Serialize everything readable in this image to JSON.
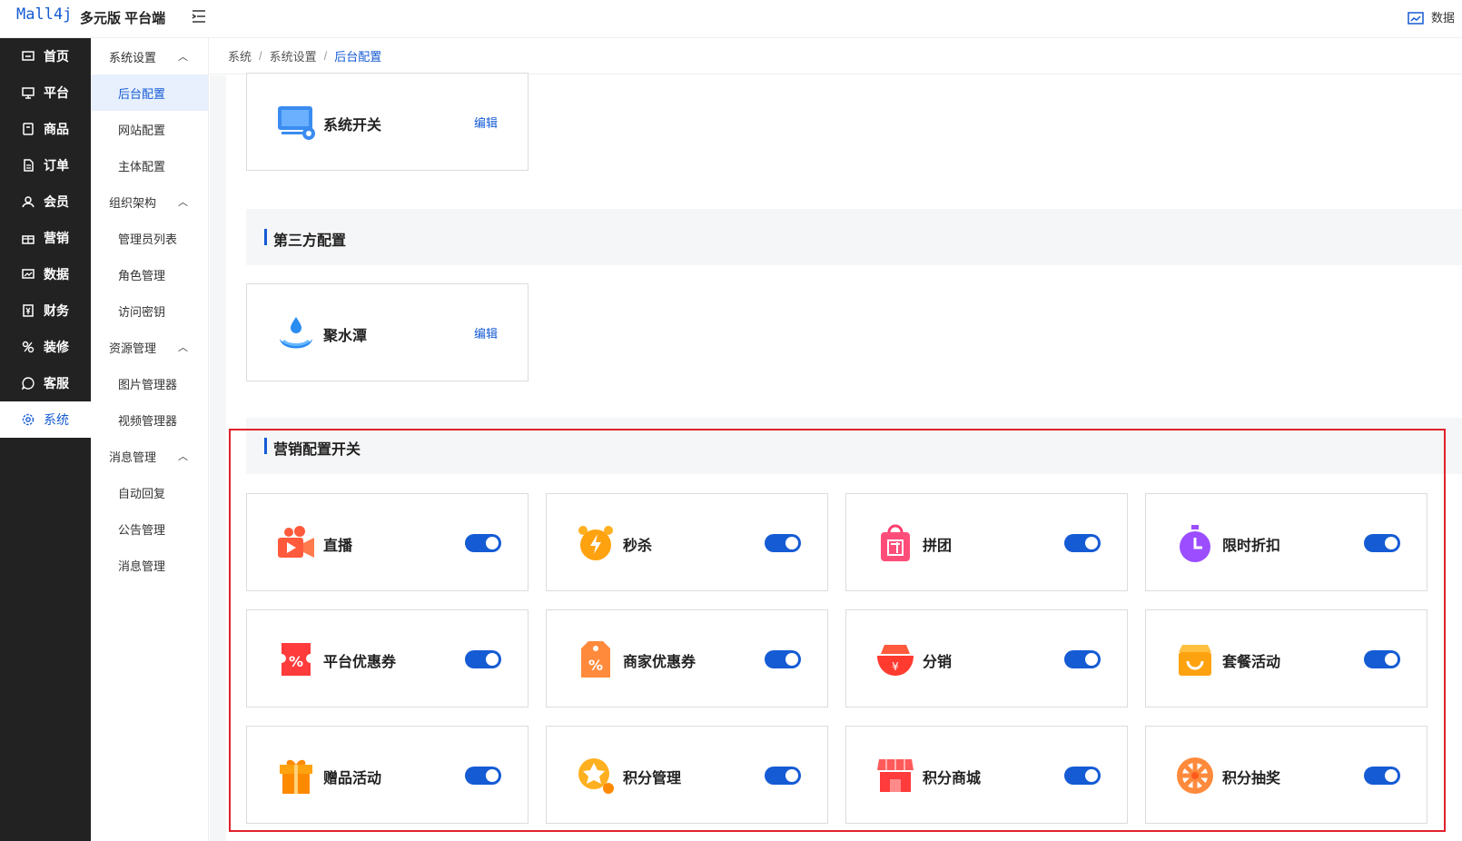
{
  "header": {
    "logo": "Mall4j",
    "brand": "多元版 平台端",
    "right_label": "数据"
  },
  "nav_primary": [
    {
      "label": "首页",
      "icon": "home-icon"
    },
    {
      "label": "平台",
      "icon": "monitor-icon"
    },
    {
      "label": "商品",
      "icon": "goods-icon"
    },
    {
      "label": "订单",
      "icon": "order-icon"
    },
    {
      "label": "会员",
      "icon": "member-icon"
    },
    {
      "label": "营销",
      "icon": "gift-icon"
    },
    {
      "label": "数据",
      "icon": "chart-icon"
    },
    {
      "label": "财务",
      "icon": "finance-icon"
    },
    {
      "label": "装修",
      "icon": "decorate-icon"
    },
    {
      "label": "客服",
      "icon": "chat-icon"
    },
    {
      "label": "系统",
      "icon": "gear-icon",
      "active": true
    }
  ],
  "nav_secondary": {
    "g1": "系统设置",
    "g1_items": [
      "后台配置",
      "网站配置",
      "主体配置"
    ],
    "g2": "组织架构",
    "g2_items": [
      "管理员列表",
      "角色管理",
      "访问密钥"
    ],
    "g3": "资源管理",
    "g3_items": [
      "图片管理器",
      "视频管理器"
    ],
    "g4": "消息管理",
    "g4_items": [
      "自动回复",
      "公告管理",
      "消息管理"
    ]
  },
  "breadcrumb": [
    "系统",
    "系统设置",
    "后台配置"
  ],
  "system_card": {
    "label": "系统开关",
    "edit": "编辑"
  },
  "third_party": {
    "title": "第三方配置",
    "card_label": "聚水潭",
    "edit": "编辑"
  },
  "marketing": {
    "title": "营销配置开关",
    "items": [
      {
        "label": "直播",
        "icon": "live-camera-icon",
        "enabled": true
      },
      {
        "label": "秒杀",
        "icon": "alarm-clock-icon",
        "enabled": true
      },
      {
        "label": "拼团",
        "icon": "group-bag-icon",
        "enabled": true
      },
      {
        "label": "限时折扣",
        "icon": "stopwatch-icon",
        "enabled": true
      },
      {
        "label": "平台优惠券",
        "icon": "coupon-icon",
        "enabled": true
      },
      {
        "label": "商家优惠券",
        "icon": "merchant-coupon-icon",
        "enabled": true
      },
      {
        "label": "分销",
        "icon": "distribution-icon",
        "enabled": true
      },
      {
        "label": "套餐活动",
        "icon": "package-icon",
        "enabled": true
      },
      {
        "label": "赠品活动",
        "icon": "gift-box-icon",
        "enabled": true
      },
      {
        "label": "积分管理",
        "icon": "points-icon",
        "enabled": true
      },
      {
        "label": "积分商城",
        "icon": "store-icon",
        "enabled": true
      },
      {
        "label": "积分抽奖",
        "icon": "lottery-wheel-icon",
        "enabled": true
      }
    ]
  },
  "colors": {
    "accent": "#155bd4",
    "highlight": "#e0222c",
    "sidebar": "#222222"
  }
}
